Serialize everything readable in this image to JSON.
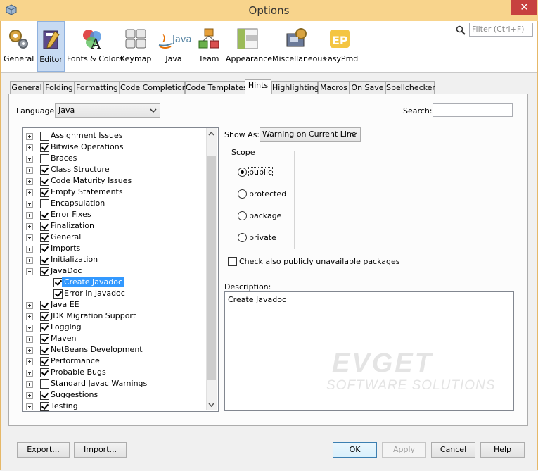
{
  "window": {
    "title": "Options",
    "close_glyph": "✕"
  },
  "categories": [
    {
      "label": "General",
      "icon": "general-gears-icon"
    },
    {
      "label": "Editor",
      "icon": "editor-pencil-icon",
      "selected": true
    },
    {
      "label": "Fonts & Colors",
      "icon": "fonts-colors-icon"
    },
    {
      "label": "Keymap",
      "icon": "keymap-icon"
    },
    {
      "label": "Java",
      "icon": "java-icon"
    },
    {
      "label": "Team",
      "icon": "team-icon"
    },
    {
      "label": "Appearance",
      "icon": "appearance-icon"
    },
    {
      "label": "Miscellaneous",
      "icon": "miscellaneous-icon"
    },
    {
      "label": "EasyPmd",
      "icon": "easypmd-icon"
    }
  ],
  "filter": {
    "placeholder": "Filter (Ctrl+F)"
  },
  "tabs": [
    "General",
    "Folding",
    "Formatting",
    "Code Completion",
    "Code Templates",
    "Hints",
    "Highlighting",
    "Macros",
    "On Save",
    "Spellchecker"
  ],
  "active_tab": "Hints",
  "language": {
    "label": "Language:",
    "value": "Java"
  },
  "search": {
    "label": "Search:",
    "value": ""
  },
  "tree": [
    {
      "label": "Assignment Issues",
      "checked": false,
      "expanded": false
    },
    {
      "label": "Bitwise Operations",
      "checked": true,
      "expanded": false
    },
    {
      "label": "Braces",
      "checked": false,
      "expanded": false
    },
    {
      "label": "Class Structure",
      "checked": true,
      "expanded": false
    },
    {
      "label": "Code Maturity Issues",
      "checked": true,
      "expanded": false
    },
    {
      "label": "Empty Statements",
      "checked": true,
      "expanded": false
    },
    {
      "label": "Encapsulation",
      "checked": false,
      "expanded": false
    },
    {
      "label": "Error Fixes",
      "checked": true,
      "expanded": false
    },
    {
      "label": "Finalization",
      "checked": true,
      "expanded": false
    },
    {
      "label": "General",
      "checked": true,
      "expanded": false
    },
    {
      "label": "Imports",
      "checked": true,
      "expanded": false
    },
    {
      "label": "Initialization",
      "checked": true,
      "expanded": false
    },
    {
      "label": "JavaDoc",
      "checked": true,
      "expanded": true
    },
    {
      "label": "Create Javadoc",
      "checked": true,
      "child": true,
      "selected": true
    },
    {
      "label": "Error in Javadoc",
      "checked": true,
      "child": true
    },
    {
      "label": "Java EE",
      "checked": true,
      "expanded": false
    },
    {
      "label": "JDK Migration Support",
      "checked": true,
      "expanded": false
    },
    {
      "label": "Logging",
      "checked": true,
      "expanded": false
    },
    {
      "label": "Maven",
      "checked": true,
      "expanded": false
    },
    {
      "label": "NetBeans Development",
      "checked": true,
      "expanded": false
    },
    {
      "label": "Performance",
      "checked": true,
      "expanded": false
    },
    {
      "label": "Probable Bugs",
      "checked": true,
      "expanded": false
    },
    {
      "label": "Standard Javac Warnings",
      "checked": false,
      "expanded": false
    },
    {
      "label": "Suggestions",
      "checked": true,
      "expanded": false
    },
    {
      "label": "Testing",
      "checked": true,
      "expanded": false
    }
  ],
  "show_as": {
    "label": "Show As:",
    "value": "Warning on Current Line"
  },
  "scope": {
    "title": "Scope",
    "options": [
      "public",
      "protected",
      "package",
      "private"
    ],
    "selected": "public"
  },
  "also_check": {
    "label": "Check also publicly unavailable packages",
    "checked": false
  },
  "description": {
    "label": "Description:",
    "text": "Create Javadoc"
  },
  "watermark": {
    "line1": "EVGET",
    "line2": "SOFTWARE SOLUTIONS"
  },
  "buttons": {
    "export": "Export...",
    "import": "Import...",
    "ok": "OK",
    "apply": "Apply",
    "cancel": "Cancel",
    "help": "Help"
  }
}
